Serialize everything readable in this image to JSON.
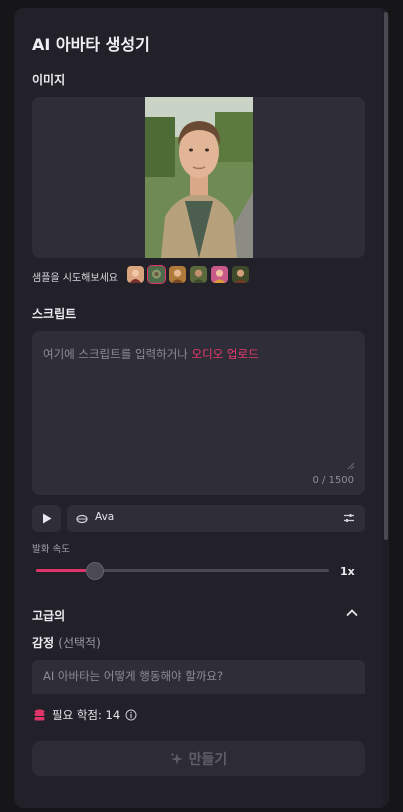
{
  "app": {
    "title": "AI 아바타 생성기"
  },
  "image_section": {
    "label": "이미지"
  },
  "samples": {
    "label": "샘플을 시도해보세요",
    "count": 6
  },
  "script_section": {
    "label": "스크립트",
    "placeholder_text": "여기에 스크립트를 입력하거나",
    "upload_link": "오디오 업로드",
    "char_count": "0 / 1500"
  },
  "voice": {
    "name": "Ava"
  },
  "speed": {
    "label": "발화 속도",
    "value_label": "1x",
    "level": 0.17
  },
  "advanced": {
    "label": "고급의",
    "expanded": true
  },
  "emotion": {
    "label": "감정",
    "optional": "(선택적)",
    "placeholder": "AI 아바타는 어떻게 행동해야 할까요?"
  },
  "credits": {
    "text": "필요 학점: 14"
  },
  "create_button": {
    "label": "만들기"
  },
  "colors": {
    "accent": "#e0356a",
    "panel": "#222129",
    "field": "#2f2e38"
  }
}
